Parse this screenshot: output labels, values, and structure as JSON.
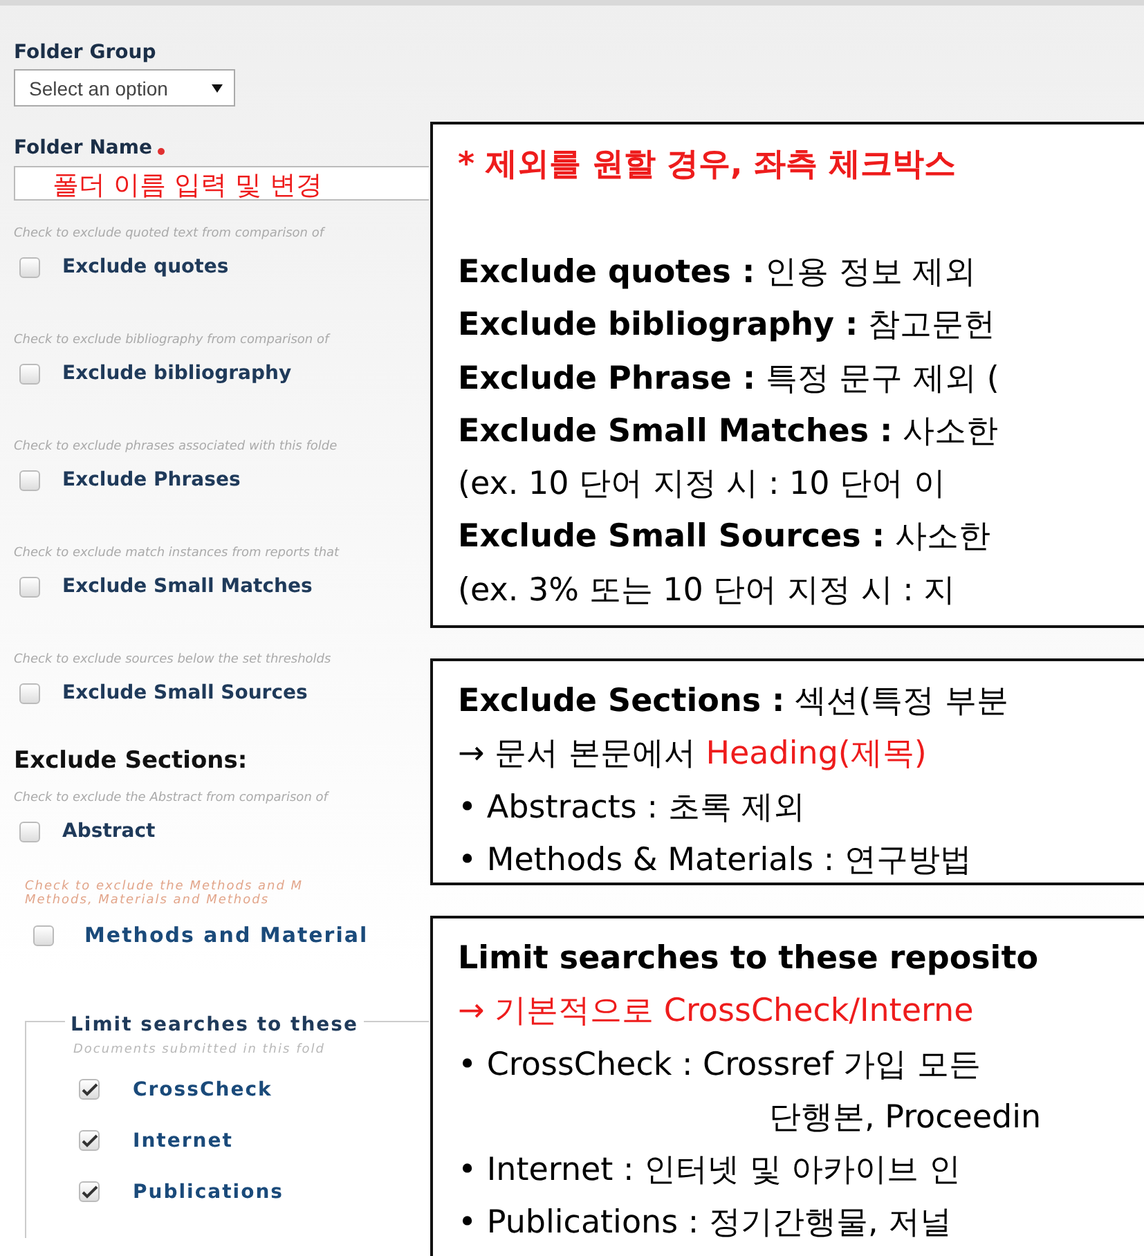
{
  "form": {
    "folder_group": {
      "label": "Folder Group",
      "select": {
        "placeholder": "Select an option"
      }
    },
    "folder_name": {
      "label": "Folder Name",
      "required": true,
      "value": "폴더 이름 입력 및 변경"
    },
    "options": [
      {
        "hint": "Check to exclude quoted text from comparison of",
        "label": "Exclude quotes",
        "checked": false
      },
      {
        "hint": "Check to exclude bibliography from comparison of",
        "label": "Exclude bibliography",
        "checked": false
      },
      {
        "hint": "Check to exclude phrases associated with this folde",
        "label": "Exclude Phrases",
        "checked": false
      },
      {
        "hint": "Check to exclude match instances from reports that",
        "label": "Exclude Small Matches",
        "checked": false
      },
      {
        "hint": "Check to exclude sources below the set thresholds",
        "label": "Exclude Small Sources",
        "checked": false
      }
    ],
    "sections_heading": "Exclude Sections:",
    "sections": [
      {
        "hint": "Check to exclude the Abstract from comparison of",
        "label": "Abstract",
        "checked": false,
        "kind": "plain"
      },
      {
        "hint": "Check to exclude the Methods and M",
        "hint_2": "Methods, Materials and Methods",
        "label": "Methods and Material",
        "checked": false,
        "kind": "wide"
      }
    ],
    "repositories": {
      "legend": "Limit searches to these",
      "hint": "Documents submitted in this fold",
      "items": [
        {
          "label": "CrossCheck",
          "checked": true
        },
        {
          "label": "Internet",
          "checked": true
        },
        {
          "label": "Publications",
          "checked": true
        }
      ]
    }
  },
  "callouts": [
    {
      "lines": [
        {
          "kind": "title",
          "parts": [
            {
              "text": "* 제외를 원할 경우, 좌측 체크박스",
              "highlight": true
            }
          ]
        },
        {
          "kind": "gap"
        },
        {
          "kind": "text",
          "parts": [
            {
              "text": "**Exclude quotes :** 인용 정보 제외",
              "highlight": false
            }
          ]
        },
        {
          "kind": "text",
          "parts": [
            {
              "text": "**Exclude bibliography :** 참고문헌",
              "highlight": false
            }
          ]
        },
        {
          "kind": "text",
          "parts": [
            {
              "text": "**Exclude Phrase :** 특정 문구 제외 (",
              "highlight": false
            }
          ]
        },
        {
          "kind": "text",
          "parts": [
            {
              "text": "**Exclude Small Matches :** 사소한",
              "highlight": false
            }
          ]
        },
        {
          "kind": "text",
          "parts": [
            {
              "text": "(ex. 10 단어  지정 시 : 10 단어 이",
              "highlight": false
            }
          ]
        },
        {
          "kind": "text",
          "parts": [
            {
              "text": "**Exclude Small Sources :** 사소한",
              "highlight": false
            }
          ]
        },
        {
          "kind": "text",
          "parts": [
            {
              "text": "(ex. 3% 또는 10 단어 지정 시 : 지",
              "highlight": false
            }
          ]
        }
      ]
    },
    {
      "lines": [
        {
          "kind": "text",
          "parts": [
            {
              "text": "**Exclude Sections :** 섹션(특정 부분",
              "highlight": false
            }
          ]
        },
        {
          "kind": "text",
          "parts": [
            {
              "text": "→ 문서 본문에서 ",
              "highlight": false
            },
            {
              "text": "Heading(제목)",
              "highlight": true
            }
          ]
        },
        {
          "kind": "text",
          "parts": [
            {
              "text": "• Abstracts : 초록 제외",
              "highlight": false
            }
          ]
        },
        {
          "kind": "text",
          "parts": [
            {
              "text": "• Methods & Materials : 연구방법",
              "highlight": false
            }
          ]
        }
      ]
    },
    {
      "lines": [
        {
          "kind": "text",
          "parts": [
            {
              "text": "**Limit searches to these reposito**",
              "highlight": false
            }
          ]
        },
        {
          "kind": "text",
          "parts": [
            {
              "text": "→ 기본적으로 CrossCheck/Interne",
              "highlight": true
            }
          ]
        },
        {
          "kind": "text",
          "parts": [
            {
              "text": "• CrossCheck : Crossref 가입 모든",
              "highlight": false
            }
          ]
        },
        {
          "kind": "continuation",
          "parts": [
            {
              "text": "단행본, Proceedin",
              "highlight": false
            }
          ]
        },
        {
          "kind": "text",
          "parts": [
            {
              "text": "• Internet : 인터넷 및 아카이브 인",
              "highlight": false
            }
          ]
        },
        {
          "kind": "text",
          "parts": [
            {
              "text": "• Publications : 정기간행물, 저널",
              "highlight": false
            }
          ]
        }
      ]
    }
  ]
}
